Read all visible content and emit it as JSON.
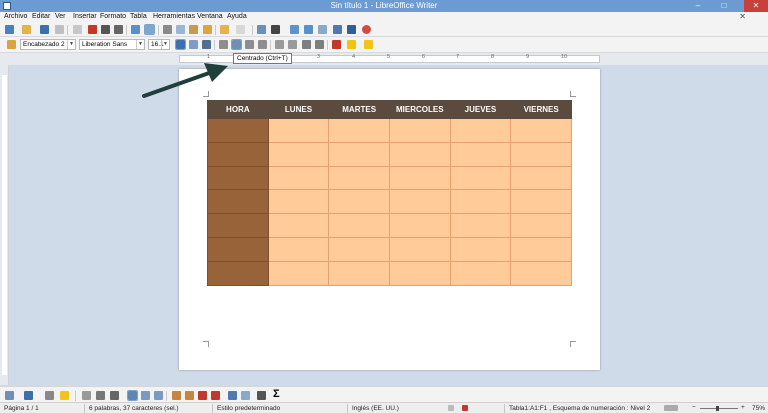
{
  "window": {
    "title": "Sin título 1 - LibreOffice Writer",
    "minimize": "–",
    "maximize": "□",
    "close": "✕"
  },
  "menu": {
    "items": [
      "Archivo",
      "Editar",
      "Ver",
      "Insertar",
      "Formato",
      "Tabla",
      "Herramientas",
      "Ventana",
      "Ayuda"
    ],
    "close_doc": "✕"
  },
  "formatting": {
    "paragraph_style": "Encabezado 2",
    "font_name": "Liberation Sans",
    "font_size": "16.1"
  },
  "tooltip": "Centrado (Ctrl+T)",
  "ruler": {
    "marks": [
      "1",
      "2",
      "3",
      "4",
      "5",
      "6",
      "7",
      "8",
      "9",
      "10"
    ]
  },
  "table": {
    "headers": [
      "HORA",
      "LUNES",
      "MARTES",
      "MIERCOLES",
      "JUEVES",
      "VIERNES"
    ],
    "row_count": 7,
    "colors": {
      "header": "#5b4a3e",
      "hour_col": "#99633a",
      "cells": "#ffcc99",
      "gridlines": "#e8a070"
    }
  },
  "statusbar": {
    "page": "Página 1 / 1",
    "words": "6 palabras, 37 caracteres (sel.)",
    "page_style": "Estilo predeterminado",
    "language": "Inglés (EE. UU.)",
    "cell_info": "Tabla1:A1:F1 , Esquema de numeración : Nivel 2",
    "zoom": "75%"
  },
  "icons": [
    "document-icon",
    "new-icon",
    "open-icon",
    "save-icon",
    "export-pdf-icon",
    "print-icon",
    "cut-icon",
    "copy-icon",
    "paste-icon",
    "undo-icon",
    "redo-icon",
    "table-icon",
    "image-icon",
    "chart-icon",
    "pilcrow-icon",
    "navigator-icon",
    "align-center-icon",
    "sum-icon"
  ]
}
